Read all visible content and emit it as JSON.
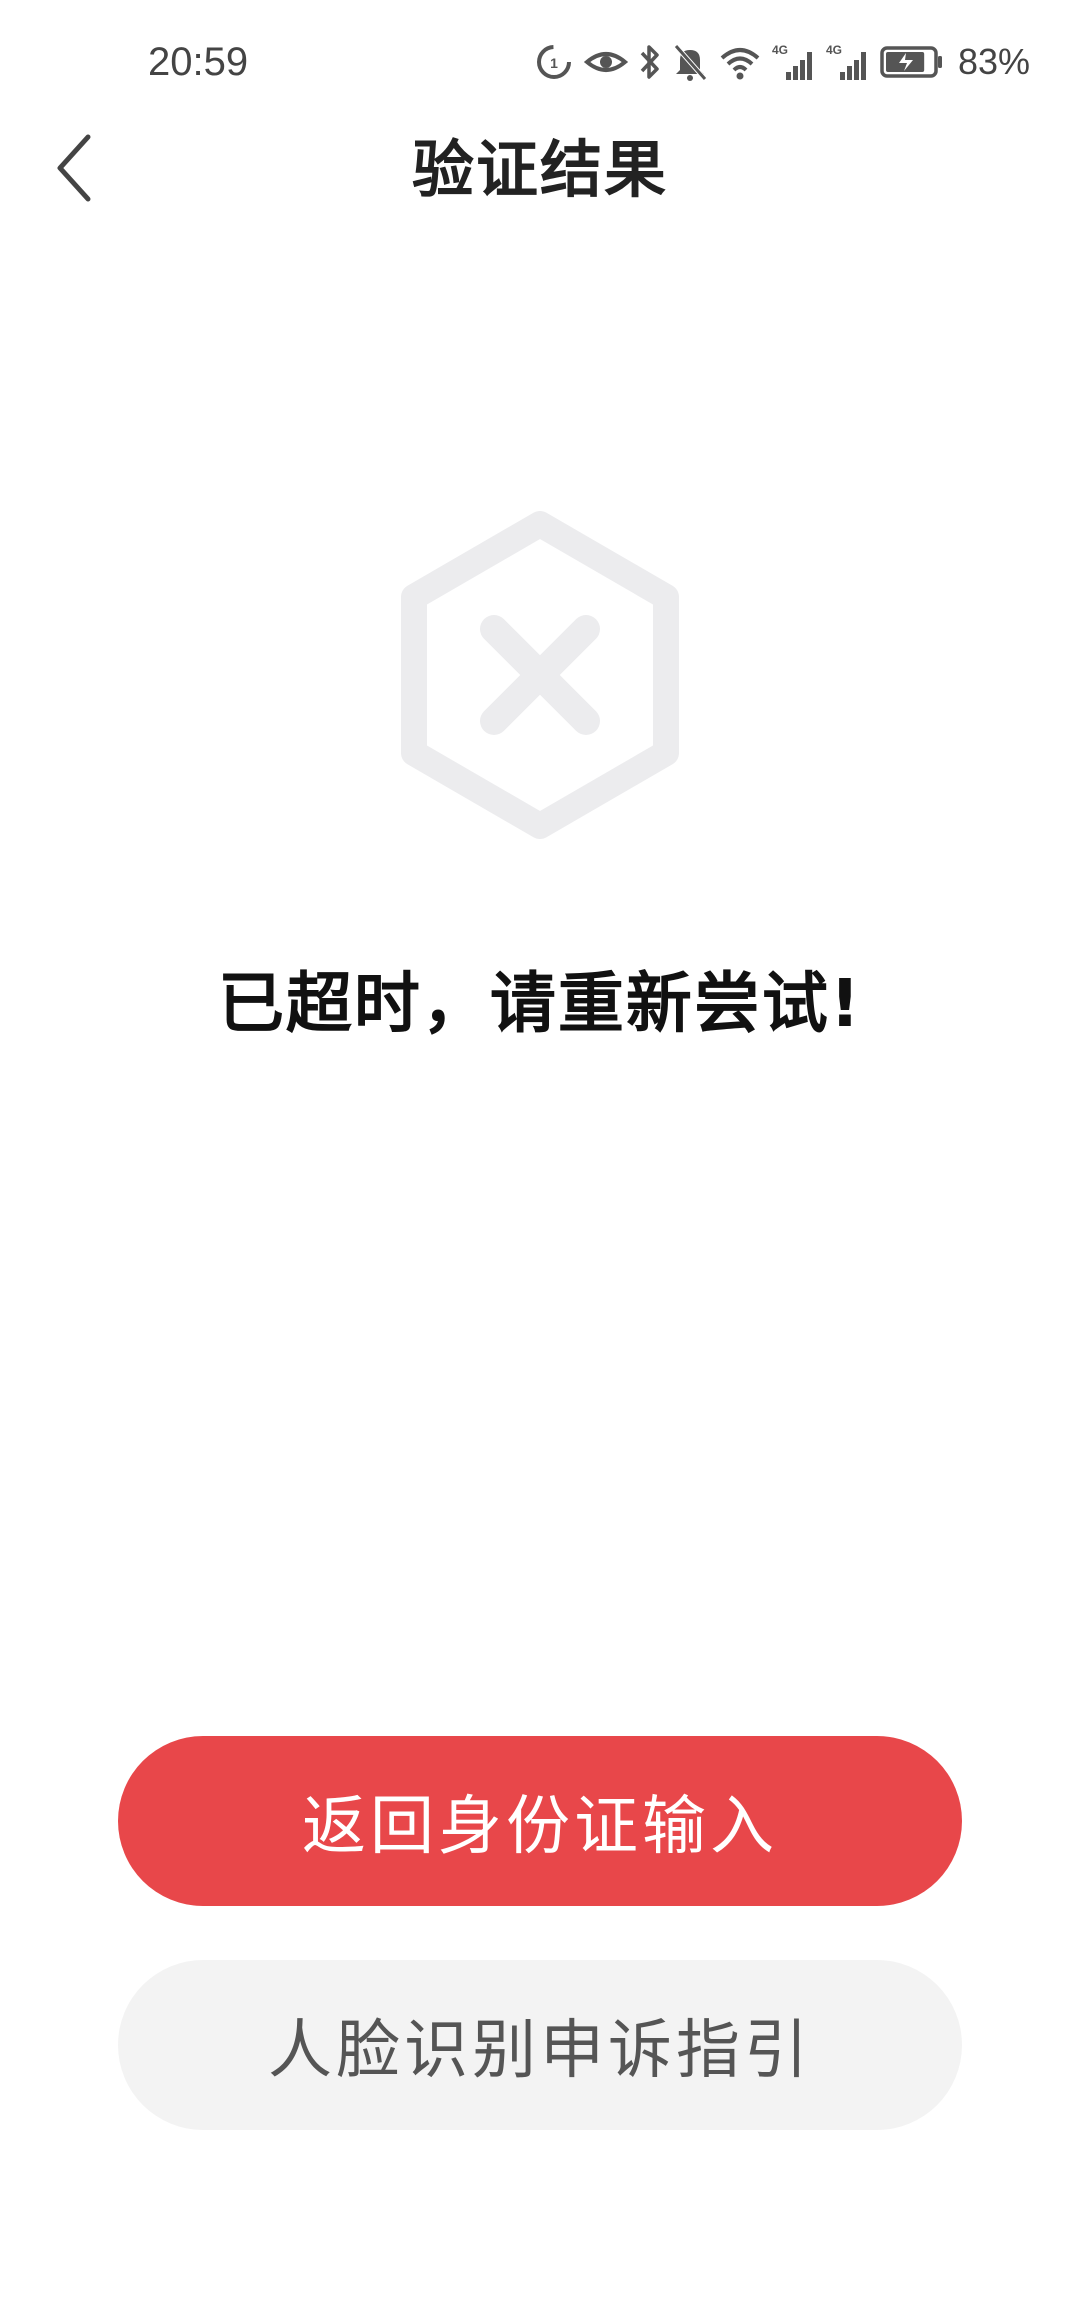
{
  "status_bar": {
    "time": "20:59",
    "battery_percent": "83%",
    "battery_level": 0.83,
    "network_labels": [
      "4G",
      "4G"
    ],
    "icons": [
      "data-saver-icon",
      "eye-icon",
      "bluetooth-icon",
      "mute-bell-icon",
      "wifi-icon",
      "signal-4g-icon",
      "signal-4g-icon",
      "battery-charging-icon"
    ]
  },
  "header": {
    "title": "验证结果",
    "back_icon": "chevron-left-icon"
  },
  "result": {
    "icon": "hexagon-x-icon",
    "message": "已超时，请重新尝试!",
    "icon_color": "#ececee"
  },
  "actions": {
    "primary_label": "返回身份证输入",
    "secondary_label": "人脸识别申诉指引",
    "primary_color": "#e8474a",
    "secondary_color": "#f3f3f3"
  }
}
